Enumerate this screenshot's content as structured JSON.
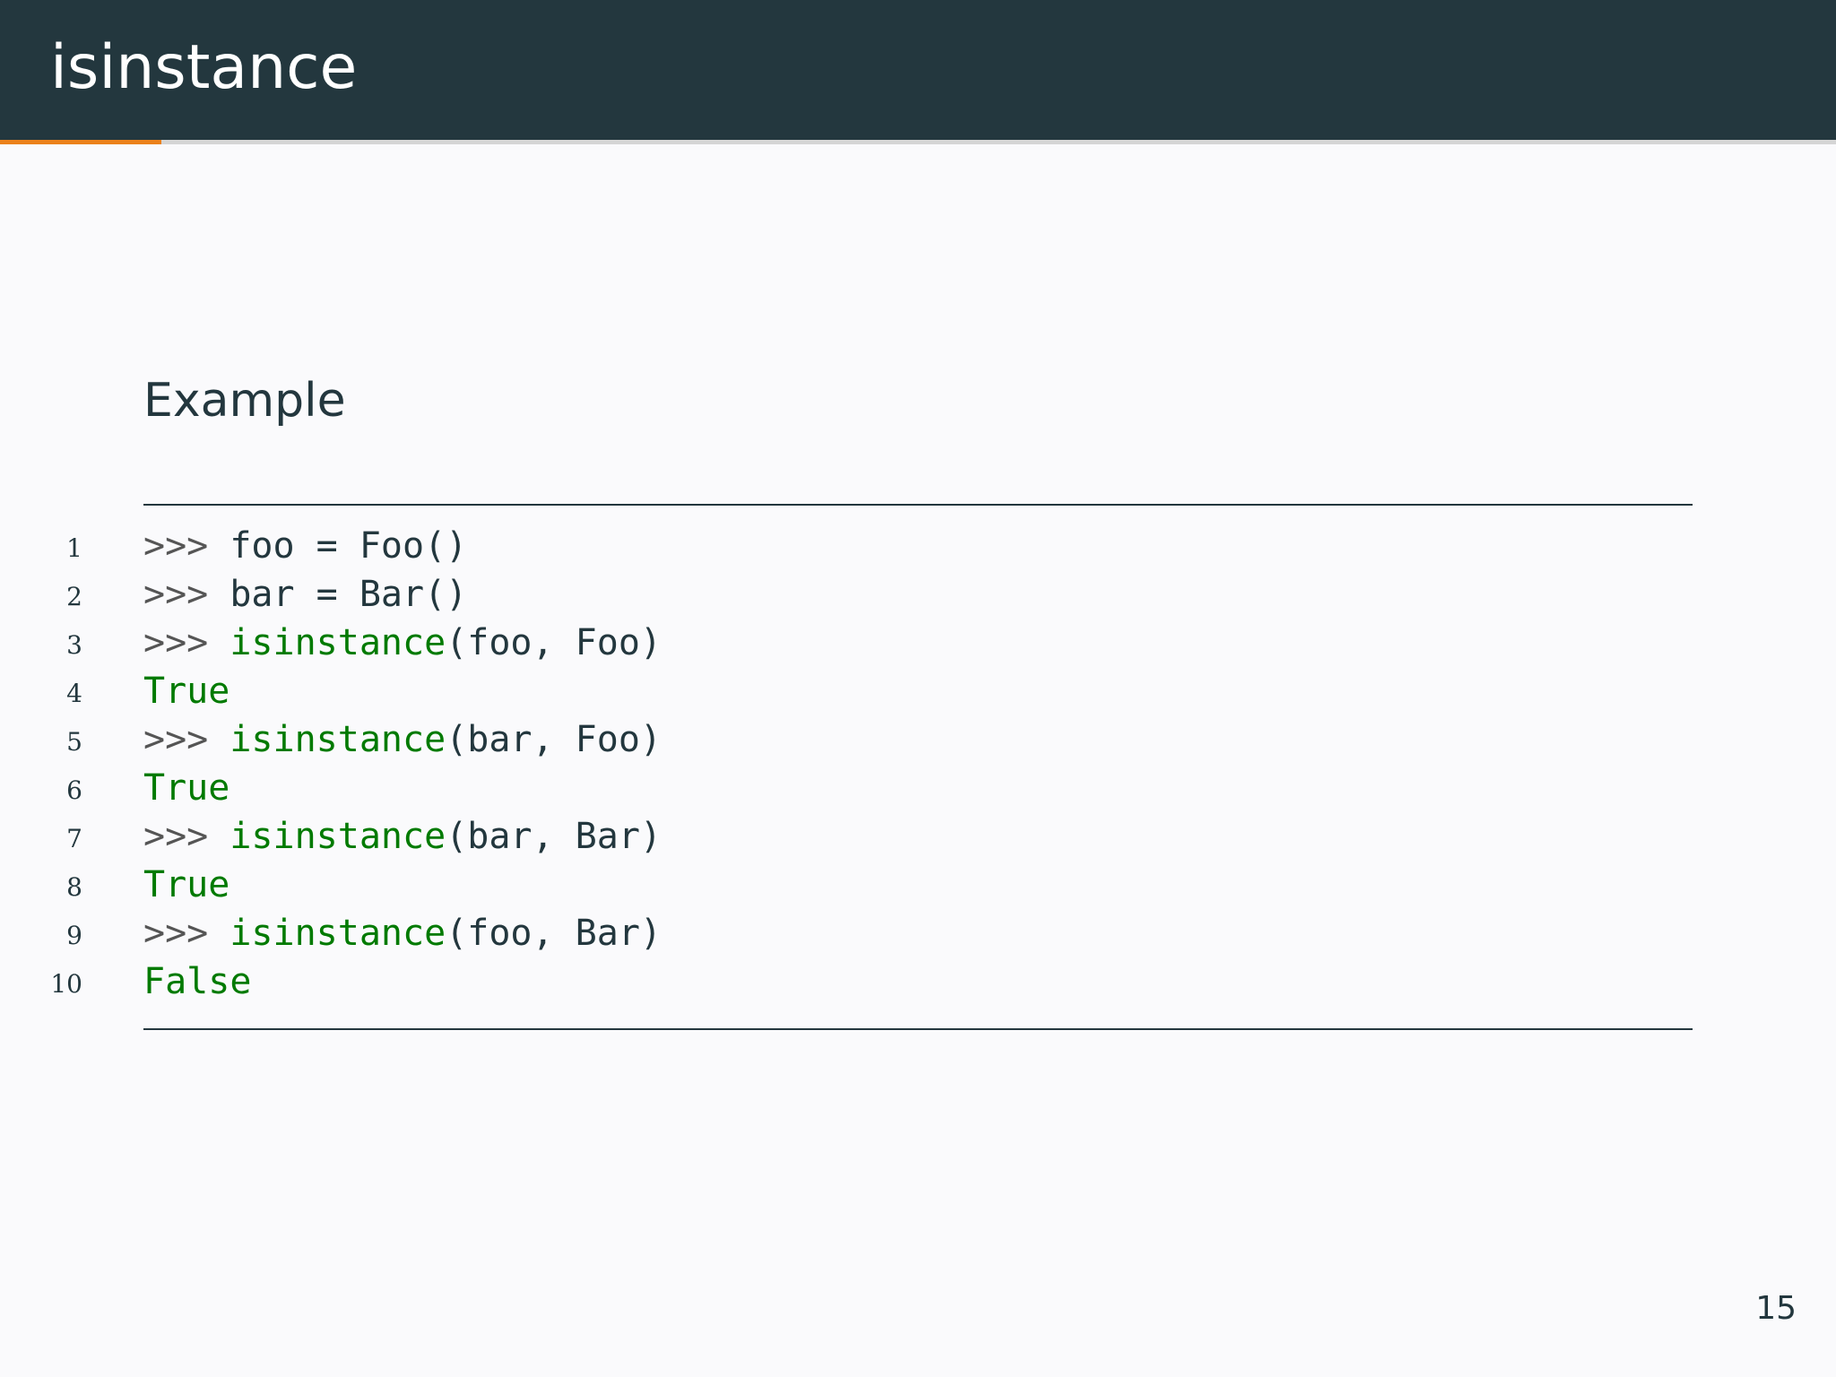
{
  "header": {
    "title": "isinstance",
    "progress": 0.088,
    "progress_color": "#eb811b"
  },
  "colors": {
    "header_background": "#23373e",
    "body_background": "#fafafc",
    "text": "#23373e",
    "code_highlight": "#007a00",
    "prompt": "#555555"
  },
  "block": {
    "title": "Example"
  },
  "code": {
    "lines": [
      {
        "number": "1",
        "prompt": ">>> ",
        "fn": "",
        "rest": "foo = Foo()",
        "output": ""
      },
      {
        "number": "2",
        "prompt": ">>> ",
        "fn": "",
        "rest": "bar = Bar()",
        "output": ""
      },
      {
        "number": "3",
        "prompt": ">>> ",
        "fn": "isinstance",
        "rest": "(foo, Foo)",
        "output": ""
      },
      {
        "number": "4",
        "prompt": "",
        "fn": "",
        "rest": "",
        "output": "True"
      },
      {
        "number": "5",
        "prompt": ">>> ",
        "fn": "isinstance",
        "rest": "(bar, Foo)",
        "output": ""
      },
      {
        "number": "6",
        "prompt": "",
        "fn": "",
        "rest": "",
        "output": "True"
      },
      {
        "number": "7",
        "prompt": ">>> ",
        "fn": "isinstance",
        "rest": "(bar, Bar)",
        "output": ""
      },
      {
        "number": "8",
        "prompt": "",
        "fn": "",
        "rest": "",
        "output": "True"
      },
      {
        "number": "9",
        "prompt": ">>> ",
        "fn": "isinstance",
        "rest": "(foo, Bar)",
        "output": ""
      },
      {
        "number": "10",
        "prompt": "",
        "fn": "",
        "rest": "",
        "output": "False"
      }
    ]
  },
  "footer": {
    "page_number": "15"
  }
}
